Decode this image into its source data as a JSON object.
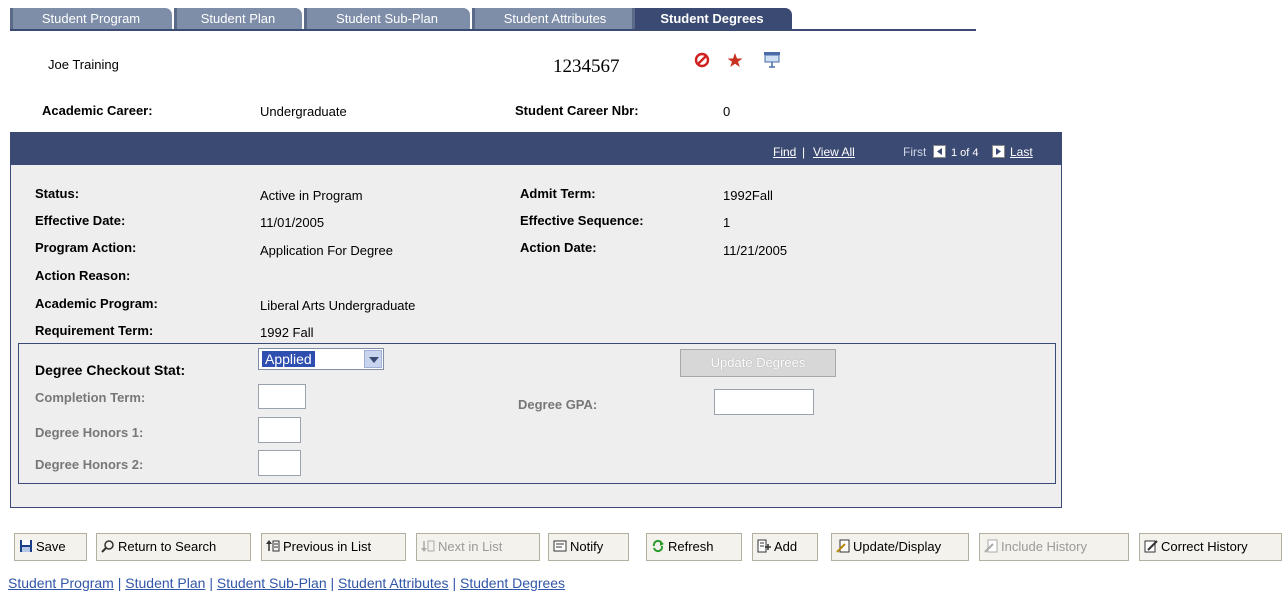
{
  "tabs": [
    {
      "label": "Student Program",
      "active": false
    },
    {
      "label": "Student Plan",
      "active": false
    },
    {
      "label": "Student Sub-Plan",
      "active": false
    },
    {
      "label": "Student Attributes",
      "active": false
    },
    {
      "label": "Student Degrees",
      "active": true
    }
  ],
  "header": {
    "name": "Joe Training",
    "id": "1234567",
    "academic_career_label": "Academic Career:",
    "academic_career_value": "Undergraduate",
    "career_nbr_label": "Student Career Nbr:",
    "career_nbr_value": "0"
  },
  "panel_nav": {
    "find": "Find",
    "separator": "|",
    "view_all": "View All",
    "first": "First",
    "count": "1 of 4",
    "last": "Last"
  },
  "fields": {
    "status_label": "Status:",
    "status_value": "Active in Program",
    "admit_term_label": "Admit Term:",
    "admit_term_value": "1992Fall",
    "effective_date_label": "Effective Date:",
    "effective_date_value": "11/01/2005",
    "effective_seq_label": "Effective Sequence:",
    "effective_seq_value": "1",
    "program_action_label": "Program Action:",
    "program_action_value": "Application For Degree",
    "action_date_label": "Action Date:",
    "action_date_value": "11/21/2005",
    "action_reason_label": "Action Reason:",
    "academic_program_label": "Academic Program:",
    "academic_program_value": "Liberal Arts Undergraduate",
    "requirement_term_label": "Requirement Term:",
    "requirement_term_value": "1992 Fall"
  },
  "degree": {
    "checkout_stat_label": "Degree Checkout Stat:",
    "checkout_stat_value": "Applied",
    "update_button": "Update Degrees",
    "completion_term_label": "Completion Term:",
    "degree_gpa_label": "Degree GPA:",
    "honors1_label": "Degree Honors 1:",
    "honors2_label": "Degree Honors 2:"
  },
  "toolbar": {
    "save": "Save",
    "return_to_search": "Return to Search",
    "previous_in_list": "Previous in List",
    "next_in_list": "Next in List",
    "notify": "Notify",
    "refresh": "Refresh",
    "add": "Add",
    "update_display": "Update/Display",
    "include_history": "Include History",
    "correct_history": "Correct History"
  },
  "footer_links": [
    "Student Program",
    "Student Plan",
    "Student Sub-Plan",
    "Student Attributes",
    "Student Degrees"
  ],
  "colors": {
    "accent": "#3b4a72",
    "tab_inactive": "#7e8ea8",
    "panel_bg": "#eeeeee",
    "link": "#3156a8"
  }
}
